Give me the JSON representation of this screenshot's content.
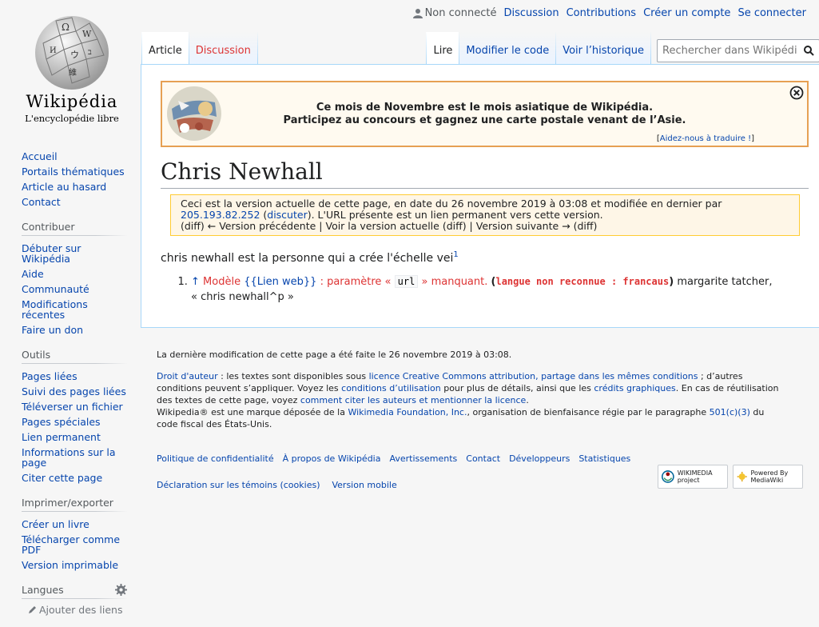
{
  "personal": {
    "status": "Non connecté",
    "links": [
      "Discussion",
      "Contributions",
      "Créer un compte",
      "Se connecter"
    ]
  },
  "logo": {
    "wordmark": "Wikipédia",
    "tagline": "L'encyclopédie libre"
  },
  "sidebar": {
    "nav": [
      "Accueil",
      "Portails thématiques",
      "Article au hasard",
      "Contact"
    ],
    "contribute_title": "Contribuer",
    "contribute": [
      "Débuter sur Wikipédia",
      "Aide",
      "Communauté",
      "Modifications récentes",
      "Faire un don"
    ],
    "tools_title": "Outils",
    "tools": [
      "Pages liées",
      "Suivi des pages liées",
      "Téléverser un fichier",
      "Pages spéciales",
      "Lien permanent",
      "Informations sur la page",
      "Citer cette page"
    ],
    "print_title": "Imprimer/exporter",
    "print": [
      "Créer un livre",
      "Télécharger comme PDF",
      "Version imprimable"
    ],
    "lang_title": "Langues",
    "add_links": "Ajouter des liens"
  },
  "tabs": {
    "left": [
      "Article",
      "Discussion"
    ],
    "right": [
      "Lire",
      "Modifier le code",
      "Voir l’historique"
    ]
  },
  "search": {
    "placeholder": "Rechercher dans Wikipédia"
  },
  "banner": {
    "line1": "Ce mois de Novembre est le mois asiatique de Wikipédia.",
    "line2": "Participez au concours et gagnez une carte postale venant de l’Asie.",
    "help_open": "[",
    "help": "Aidez-nous à traduire !",
    "help_close": "]"
  },
  "page": {
    "title": "Chris Newhall",
    "notice": {
      "line1": "Ceci est la version actuelle de cette page, en date du 26 novembre 2019 à 03:08 et modifiée en dernier par",
      "ip": "205.193.82.252",
      "discuss": "discuter",
      "line2_rest": ". L'URL présente est un lien permanent vers cette version.",
      "line3": "(diff) ← Version précédente | Voir la version actuelle (diff) | Version suivante → (diff)"
    },
    "body": "chris newhall est la personne qui a crée l'échelle vei",
    "ref_mark": "1",
    "ref": {
      "arrow": "↑",
      "err_prefix": "Modèle",
      "err_template": "{{Lien web}}",
      "err_mid": ": paramètre «",
      "err_param": "url",
      "err_suffix": "» manquant.",
      "lang_open": "(",
      "lang_err": "langue non reconnue : francaus",
      "lang_close": ")",
      "rest": "margarite tatcher,",
      "line2": "« chris newhall^p »"
    }
  },
  "footer": {
    "lastmod": "La dernière modification de cette page a été faite le 26 novembre 2019 à 03:08.",
    "copyright_link": "Droit d'auteur",
    "c1": ": les textes sont disponibles sous",
    "cc_link": "licence Creative Commons attribution, partage dans les mêmes conditions",
    "c2": "; d’autres conditions peuvent s’appliquer. Voyez les",
    "terms_link": "conditions d’utilisation",
    "c3": "pour plus de détails, ainsi que les",
    "credits_link": "crédits graphiques",
    "c4": ". En cas de réutilisation des textes de cette page, voyez",
    "cite_link": "comment citer les auteurs et mentionner la licence",
    "c5": ".",
    "c6": "Wikipedia® est une marque déposée de la",
    "wmf_link": "Wikimedia Foundation, Inc.",
    "c7": ", organisation de bienfaisance régie par le paragraphe",
    "tax_link": "501(c)(3)",
    "c8": "du code fiscal des États-Unis.",
    "places": [
      "Politique de confidentialité",
      "À propos de Wikipédia",
      "Avertissements",
      "Contact",
      "Développeurs",
      "Statistiques"
    ],
    "places2": [
      "Déclaration sur les témoins (cookies)",
      "Version mobile"
    ],
    "wm_badge": "WIKIMEDIA project",
    "mw_badge": "Powered By MediaWiki"
  }
}
